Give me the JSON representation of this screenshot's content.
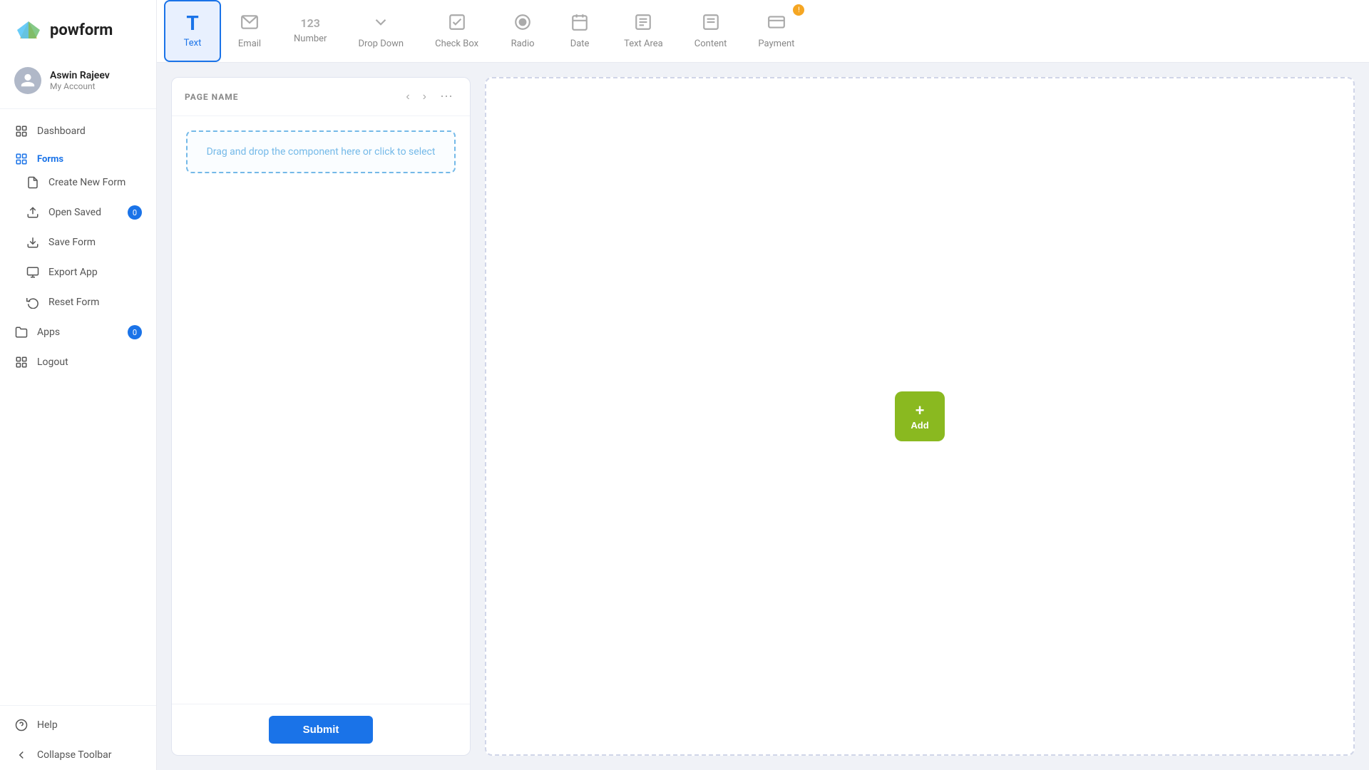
{
  "logo": {
    "text": "powform"
  },
  "user": {
    "name": "Aswin Rajeev",
    "sub": "My Account"
  },
  "sidebar": {
    "items": [
      {
        "id": "dashboard",
        "label": "Dashboard",
        "icon": "dashboard"
      },
      {
        "id": "forms",
        "label": "Forms",
        "icon": "forms",
        "active": true,
        "section": true
      },
      {
        "id": "create-new-form",
        "label": "Create New Form",
        "icon": "new-form"
      },
      {
        "id": "open-saved",
        "label": "Open Saved",
        "icon": "open-saved",
        "badge": "0"
      },
      {
        "id": "save-form",
        "label": "Save Form",
        "icon": "save"
      },
      {
        "id": "export-app",
        "label": "Export App",
        "icon": "export"
      },
      {
        "id": "reset-form",
        "label": "Reset Form",
        "icon": "reset"
      },
      {
        "id": "apps",
        "label": "Apps",
        "icon": "apps",
        "badge": "0"
      },
      {
        "id": "logout",
        "label": "Logout",
        "icon": "logout"
      }
    ],
    "bottom": [
      {
        "id": "help",
        "label": "Help",
        "icon": "help"
      },
      {
        "id": "collapse-toolbar",
        "label": "Collapse Toolbar",
        "icon": "collapse"
      }
    ]
  },
  "toolbar": {
    "items": [
      {
        "id": "text",
        "label": "Text",
        "icon": "T",
        "active": true
      },
      {
        "id": "email",
        "label": "Email",
        "icon": "email"
      },
      {
        "id": "number",
        "label": "Number",
        "icon": "123"
      },
      {
        "id": "dropdown",
        "label": "Drop Down",
        "icon": "dropdown"
      },
      {
        "id": "checkbox",
        "label": "Check Box",
        "icon": "checkbox"
      },
      {
        "id": "radio",
        "label": "Radio",
        "icon": "radio"
      },
      {
        "id": "date",
        "label": "Date",
        "icon": "date"
      },
      {
        "id": "textarea",
        "label": "Text Area",
        "icon": "textarea"
      },
      {
        "id": "content",
        "label": "Content",
        "icon": "content"
      },
      {
        "id": "payment",
        "label": "Payment",
        "icon": "payment",
        "badge": true
      }
    ]
  },
  "form_panel": {
    "page_name_label": "PAGE NAME",
    "drop_zone_text": "Drag and drop the component here or click to select",
    "submit_label": "Submit"
  },
  "right_panel": {
    "add_label": "Add",
    "add_plus": "+"
  }
}
